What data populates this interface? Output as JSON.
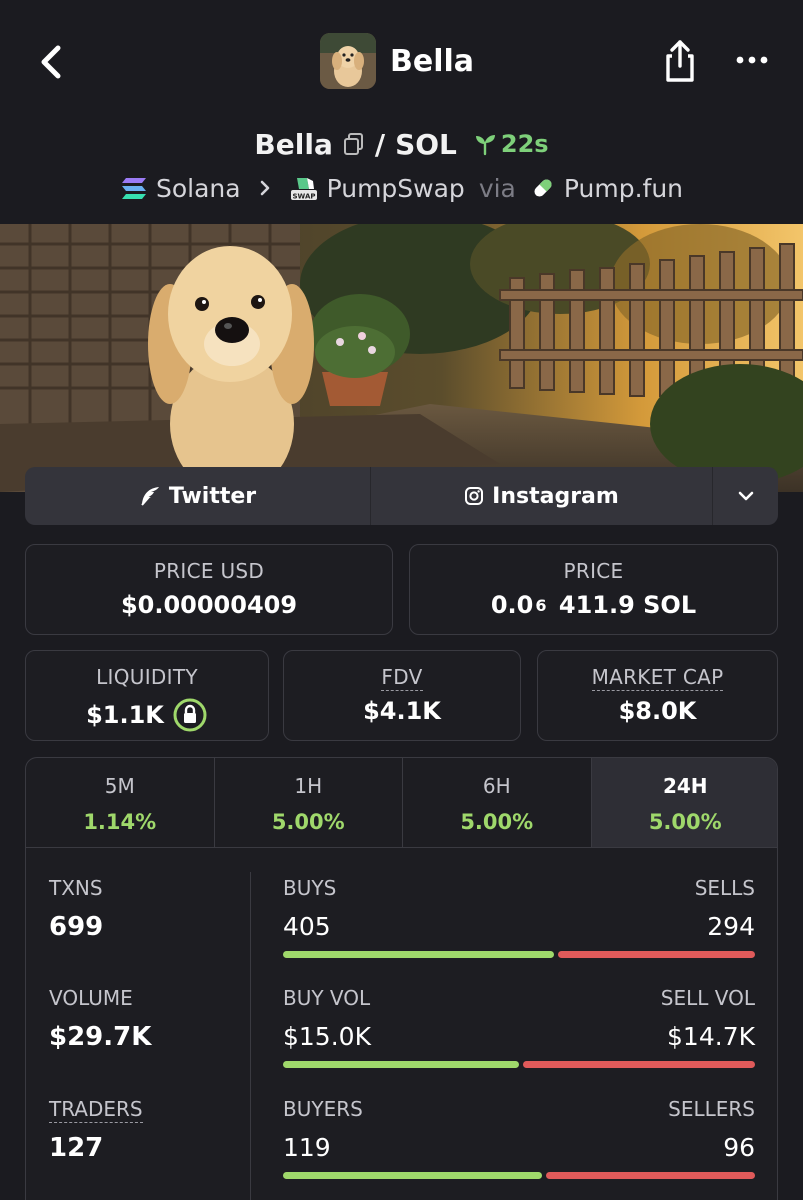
{
  "header": {
    "title": "Bella"
  },
  "pair": {
    "base": "Bella",
    "separator": "/",
    "quote": "SOL",
    "age": "22s"
  },
  "chain": {
    "network": "Solana",
    "dex": "PumpSwap",
    "dex_badge": "SWAP",
    "via": "via",
    "launchpad": "Pump.fun"
  },
  "socials": {
    "twitter": "Twitter",
    "instagram": "Instagram"
  },
  "price": {
    "usd_label": "PRICE USD",
    "usd_value": "$0.00000409",
    "native_label": "PRICE",
    "native_prefix": "0.0",
    "native_zeros": "6",
    "native_suffix": "411.9 SOL"
  },
  "metrics": {
    "liquidity_label": "LIQUIDITY",
    "liquidity_value": "$1.1K",
    "fdv_label": "FDV",
    "fdv_value": "$4.1K",
    "mcap_label": "MARKET CAP",
    "mcap_value": "$8.0K"
  },
  "timeframes": [
    {
      "label": "5M",
      "change": "1.14%"
    },
    {
      "label": "1H",
      "change": "5.00%"
    },
    {
      "label": "6H",
      "change": "5.00%"
    },
    {
      "label": "24H",
      "change": "5.00%"
    }
  ],
  "stats": {
    "txns_label": "TXNS",
    "txns_value": "699",
    "buys_label": "BUYS",
    "buys_value": "405",
    "sells_label": "SELLS",
    "sells_value": "294",
    "volume_label": "VOLUME",
    "volume_value": "$29.7K",
    "buy_vol_label": "BUY VOL",
    "buy_vol_value": "$15.0K",
    "sell_vol_label": "SELL VOL",
    "sell_vol_value": "$14.7K",
    "traders_label": "TRADERS",
    "traders_value": "127",
    "buyers_label": "BUYERS",
    "buyers_value": "119",
    "sellers_label": "SELLERS",
    "sellers_value": "96",
    "buy_share_txns": 0.579,
    "buy_share_volume": 0.505,
    "buy_share_traders": 0.554
  },
  "colors": {
    "positive": "#9fd86b",
    "negative": "#e05a5a",
    "background": "#1b1b20"
  }
}
